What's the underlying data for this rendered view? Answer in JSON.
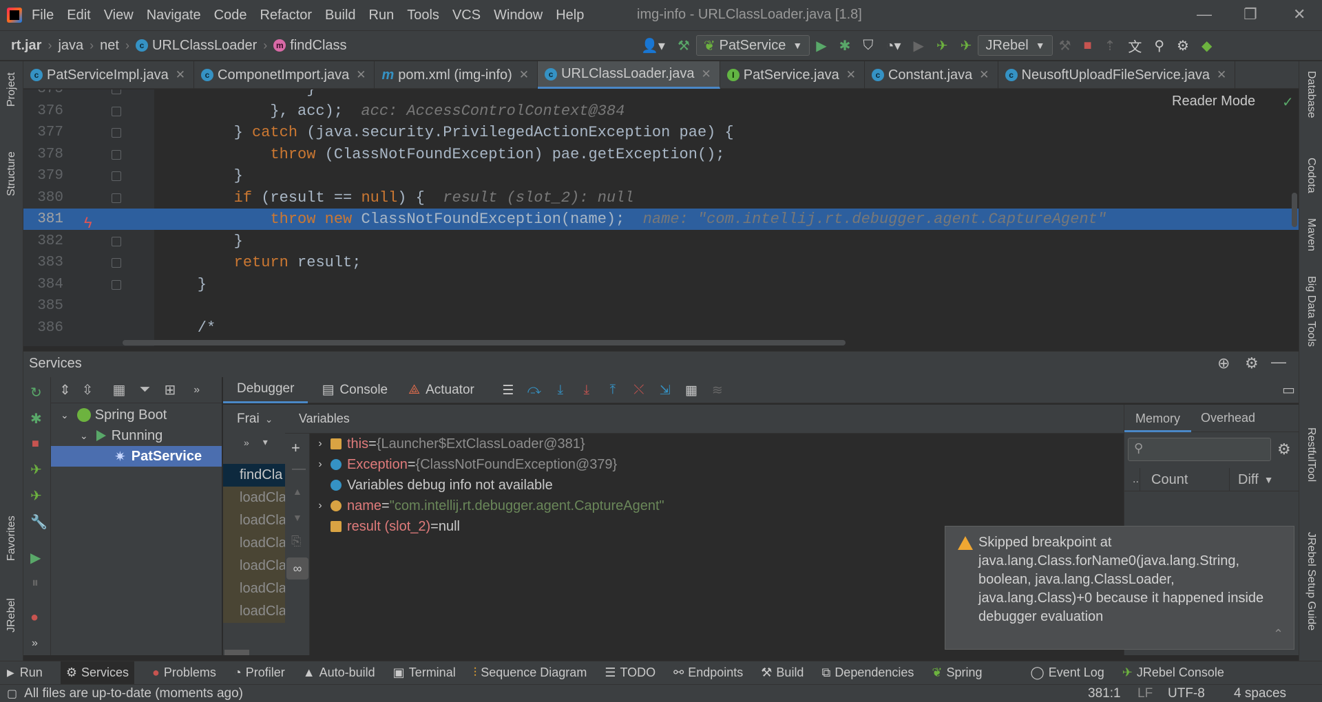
{
  "menubar": {
    "items": [
      "File",
      "Edit",
      "View",
      "Navigate",
      "Code",
      "Refactor",
      "Build",
      "Run",
      "Tools",
      "VCS",
      "Window",
      "Help"
    ],
    "title": "img-info - URLClassLoader.java [1.8]"
  },
  "breadcrumb": [
    "rt.jar",
    "java",
    "net",
    "URLClassLoader",
    "findClass"
  ],
  "toolbar": {
    "run_config": "PatService",
    "jrebel": "JRebel"
  },
  "tabs": [
    {
      "label": "PatServiceImpl.java",
      "icon": "class-icon"
    },
    {
      "label": "ComponetImport.java",
      "icon": "class-icon"
    },
    {
      "label": "pom.xml (img-info)",
      "icon": "maven-icon"
    },
    {
      "label": "URLClassLoader.java",
      "icon": "class-icon",
      "active": true
    },
    {
      "label": "PatService.java",
      "icon": "interface-icon"
    },
    {
      "label": "Constant.java",
      "icon": "class-icon"
    },
    {
      "label": "NeusoftUploadFileService.java",
      "icon": "class-icon"
    }
  ],
  "left_strip": [
    "Project",
    "Structure",
    "Favorites",
    "JRebel"
  ],
  "right_strip": [
    "Database",
    "Codota",
    "Maven",
    "Big Data Tools",
    "RestfulTool",
    "JRebel Setup Guide"
  ],
  "editor": {
    "reader_mode": "Reader Mode",
    "lines": [
      {
        "num": "375",
        "code": "                }"
      },
      {
        "num": "376",
        "code": "            }, acc);",
        "hint": "  acc: AccessControlContext@384"
      },
      {
        "num": "377",
        "code": "        } catch (java.security.PrivilegedActionException pae) {"
      },
      {
        "num": "378",
        "code": "            throw (ClassNotFoundException) pae.getException();"
      },
      {
        "num": "379",
        "code": "        }"
      },
      {
        "num": "380",
        "code": "        if (result == null) {",
        "hint": "  result (slot_2): null"
      },
      {
        "num": "381",
        "code": "            throw new ClassNotFoundException(name);",
        "hint": "  name: \"com.intellij.rt.debugger.agent.CaptureAgent\"",
        "highlighted": true
      },
      {
        "num": "382",
        "code": "        }"
      },
      {
        "num": "383",
        "code": "        return result;"
      },
      {
        "num": "384",
        "code": "    }"
      },
      {
        "num": "385",
        "code": ""
      },
      {
        "num": "386",
        "code": "    /*"
      }
    ]
  },
  "services": {
    "title": "Services",
    "tree": [
      {
        "label": "Spring Boot"
      },
      {
        "label": "Running"
      },
      {
        "label": "PatService",
        "selected": true
      }
    ]
  },
  "debugger": {
    "tabs": [
      "Debugger",
      "Console",
      "Actuator"
    ],
    "frames_label": "Frai",
    "frames": [
      "findCla",
      "loadCla",
      "loadCla",
      "loadCla",
      "loadCla",
      "loadCla",
      "loadCla"
    ],
    "variables_label": "Variables",
    "variables": [
      {
        "name": "this",
        "eq": " = ",
        "value": "{Launcher$ExtClassLoader@381}",
        "kind": "field"
      },
      {
        "name": "Exception",
        "eq": " = ",
        "value": "{ClassNotFoundException@379}",
        "kind": "exception"
      },
      {
        "name": "Variables debug info not available",
        "eq": "",
        "value": "",
        "kind": "info"
      },
      {
        "name": "name",
        "eq": " = ",
        "value": "\"com.intellij.rt.debugger.agent.CaptureAgent\"",
        "kind": "param"
      },
      {
        "name": "result (slot_2)",
        "eq": " = ",
        "value": "null",
        "kind": "field"
      }
    ]
  },
  "memory": {
    "tabs": [
      "Memory",
      "Overhead"
    ],
    "col_dots": "..",
    "col_count": "Count",
    "col_diff": "Diff"
  },
  "notification": {
    "text": "Skipped breakpoint at java.lang.Class.forName0(java.lang.String, boolean, java.lang.ClassLoader, java.lang.Class)+0 because it happened inside debugger evaluation"
  },
  "bottom_tabs": [
    "Run",
    "Services",
    "Problems",
    "Profiler",
    "Auto-build",
    "Terminal",
    "Sequence Diagram",
    "TODO",
    "Endpoints",
    "Build",
    "Dependencies",
    "Spring",
    "Event Log",
    "JRebel Console"
  ],
  "status": {
    "message": "All files are up-to-date (moments ago)",
    "position": "381:1",
    "line_sep": "LF",
    "encoding": "UTF-8",
    "indent": "4 spaces"
  },
  "colors": {
    "accent": "#4a88c7",
    "highlight_line": "#2d5f9e",
    "keyword": "#cc7832",
    "string": "#6a8759"
  }
}
